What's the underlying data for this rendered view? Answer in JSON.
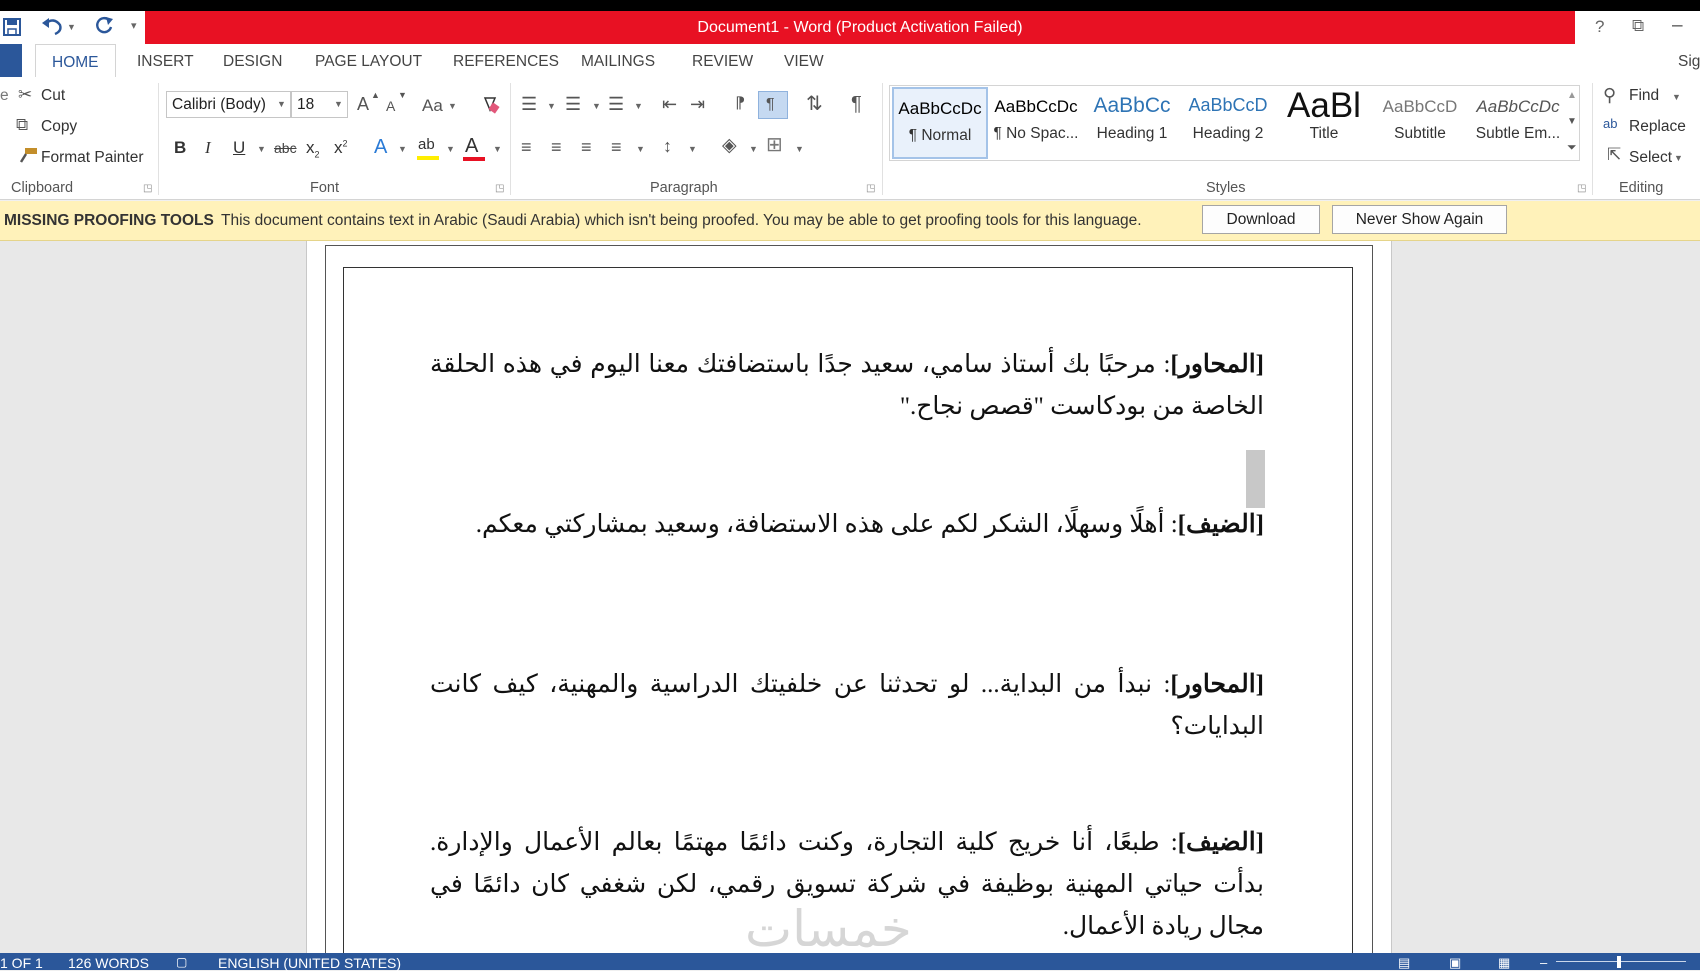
{
  "window": {
    "title": "Document1 -  Word (Product Activation Failed)",
    "help": "?",
    "restore": "⧉",
    "minimize": "–",
    "sign_in": "Sig"
  },
  "qat": {
    "save": "save-icon",
    "undo": "undo-icon",
    "redo": "redo-icon",
    "customize": "customize-icon"
  },
  "tabs": [
    "HOME",
    "INSERT",
    "DESIGN",
    "PAGE LAYOUT",
    "REFERENCES",
    "MAILINGS",
    "REVIEW",
    "VIEW"
  ],
  "clipboard": {
    "cut": "Cut",
    "copy": "Copy",
    "format_painter": "Format Painter",
    "label": "Clipboard",
    "paste_partial": "e"
  },
  "font": {
    "family": "Calibri (Body)",
    "size": "18",
    "label": "Font",
    "grow": "A",
    "shrink": "A",
    "case": "Aa",
    "bold": "B",
    "italic": "I",
    "underline": "U",
    "strike": "abc",
    "sub": "x",
    "sup": "x",
    "sub_mark": "2",
    "sup_mark": "2",
    "effects": "A",
    "highlight": "ab",
    "color": "A"
  },
  "paragraph": {
    "label": "Paragraph",
    "pilcrow": "¶"
  },
  "styles": {
    "label": "Styles",
    "items": [
      {
        "preview": "AaBbCcDc",
        "name": "¶ Normal"
      },
      {
        "preview": "AaBbCcDc",
        "name": "¶ No Spac..."
      },
      {
        "preview": "AaBbCc",
        "name": "Heading 1"
      },
      {
        "preview": "AaBbCcD",
        "name": "Heading 2"
      },
      {
        "preview": "AaBl",
        "name": "Title"
      },
      {
        "preview": "AaBbCcD",
        "name": "Subtitle"
      },
      {
        "preview": "AaBbCcDc",
        "name": "Subtle Em..."
      }
    ]
  },
  "editing": {
    "label": "Editing",
    "find": "Find",
    "replace": "Replace",
    "select": "Select"
  },
  "infobar": {
    "title": "MISSING PROOFING TOOLS",
    "message": "This document contains text in Arabic (Saudi Arabia) which isn't being proofed. You may be able to get proofing tools for this language.",
    "download": "Download",
    "never_show": "Never Show Again"
  },
  "document": {
    "paragraphs": [
      {
        "speaker": "[المحاور]",
        "text": ": مرحبًا بك أستاذ سامي، سعيد جدًا باستضافتك معنا اليوم في هذه الحلقة الخاصة من بودكاست \"قصص نجاح.\""
      },
      {
        "speaker": "[الضيف]",
        "text": ": أهلًا وسهلًا، الشكر لكم على هذه الاستضافة، وسعيد بمشاركتي معكم."
      },
      {
        "speaker": "[المحاور]",
        "text": ": نبدأ من البداية... لو تحدثنا عن خلفيتك الدراسية والمهنية، كيف كانت البدايات؟"
      },
      {
        "speaker": "[الضيف]",
        "text": ": طبعًا، أنا خريج كلية التجارة، وكنت دائمًا مهتمًا بعالم الأعمال والإدارة. بدأت حياتي المهنية بوظيفة في شركة تسويق رقمي، لكن شغفي كان دائمًا في مجال ريادة الأعمال."
      }
    ],
    "watermark": "خمسات"
  },
  "status": {
    "page": "1 OF 1",
    "words": "126 WORDS",
    "language": "ENGLISH (UNITED STATES)"
  },
  "colors": {
    "accent": "#2b579a",
    "title_bg": "#e81123",
    "infobar_bg": "#fff2ba"
  }
}
